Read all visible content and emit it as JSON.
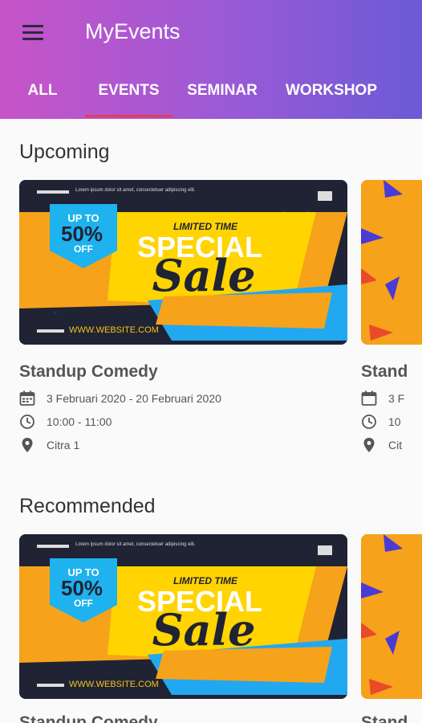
{
  "app": {
    "title": "MyEvents"
  },
  "tabs": [
    {
      "label": "ALL",
      "active": false
    },
    {
      "label": "EVENTS",
      "active": true
    },
    {
      "label": "SEMINAR",
      "active": false
    },
    {
      "label": "WORKSHOP",
      "active": false
    }
  ],
  "colors": {
    "accent": "#e8395a",
    "gradient_start": "#c754c8",
    "gradient_end": "#6b5ad6"
  },
  "sections": {
    "upcoming": {
      "title": "Upcoming",
      "event": {
        "name": "Standup Comedy",
        "date": "3 Februari 2020 - 20 Februari 2020",
        "time": "10:00 - 11:00",
        "location": "Citra 1"
      },
      "peek": {
        "name": "Stand",
        "date": "3 F",
        "time": "10",
        "location": "Cit"
      }
    },
    "recommended": {
      "title": "Recommended",
      "event": {
        "name": "Standup Comedy"
      },
      "peek": {
        "name": "Stand"
      }
    }
  },
  "banner": {
    "up_to": "UP TO",
    "percent": "50%",
    "off": "OFF",
    "limited": "LIMITED TIME",
    "special": "SPECIAL",
    "sale": "Sale",
    "website": "WWW.WEBSITE.COM",
    "lorem": "Lorem ipsum dolor sit amet, consectetuer adipiscing elit."
  }
}
